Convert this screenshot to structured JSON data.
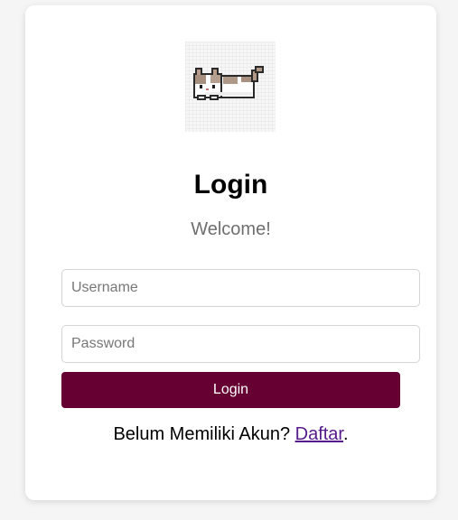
{
  "logo": {
    "icon": "pixel-cat-icon",
    "alt": "cat logo"
  },
  "heading": "Login",
  "subheading": "Welcome!",
  "form": {
    "username_placeholder": "Username",
    "password_placeholder": "Password",
    "submit_label": "Login"
  },
  "signup": {
    "prompt": "Belum Memiliki Akun? ",
    "link_label": "Daftar",
    "suffix": "."
  },
  "colors": {
    "page_background": "#f5f5f5",
    "card_background": "#ffffff",
    "button": "#660033",
    "link": "#551a8b"
  }
}
